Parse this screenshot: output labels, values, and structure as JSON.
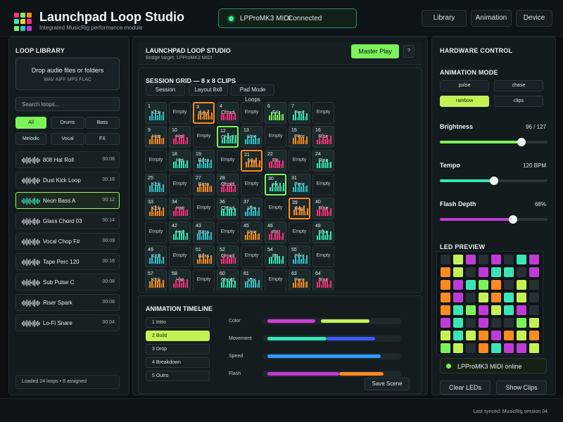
{
  "header": {
    "title": "Launchpad Loop Studio",
    "subtitle": "Integrated MusicRig performance module",
    "connection_device": "LPProMK3 MIDI",
    "connection_status": "Connected",
    "nav": [
      "Library",
      "Animation",
      "Device"
    ]
  },
  "library": {
    "title": "LOOP LIBRARY",
    "drop_title": "Drop audio files or folders",
    "drop_formats": "WAV  AIFF  MP3  FLAC",
    "search_placeholder": "Search loops...",
    "filters": [
      "All",
      "Drums",
      "Bass",
      "Melodic",
      "Vocal",
      "FX"
    ],
    "active_filter": "All",
    "loops": [
      {
        "name": "808 Hat Roll",
        "duration": "00:08"
      },
      {
        "name": "Dust Kick Loop",
        "duration": "00:16"
      },
      {
        "name": "Neon Bass A",
        "duration": "00:12"
      },
      {
        "name": "Glass Chord 03",
        "duration": "00:14"
      },
      {
        "name": "Vocal Chop F#",
        "duration": "00:09"
      },
      {
        "name": "Tape Perc 120",
        "duration": "00:16"
      },
      {
        "name": "Sub Pulse C",
        "duration": "00:08"
      },
      {
        "name": "Riser Spark",
        "duration": "00:06"
      },
      {
        "name": "Lo-Fi Snare",
        "duration": "00:04"
      }
    ],
    "active_loop": "Neon Bass A",
    "footer": "Loaded 24 loops  •  8 assigned"
  },
  "main": {
    "title": "LAUNCHPAD LOOP STUDIO",
    "bridge": "Bridge target: LPProMK3 MIDI",
    "master_play": "Master Play",
    "mini_btn": "?",
    "grid_title": "SESSION GRID — 8 x 8 CLIPS",
    "tabs": [
      "Session",
      "Layout 8x8",
      "Pad Mode Loops"
    ],
    "empty_label": "Empty",
    "pads": [
      [
        {
          "n": "1",
          "t": "Kick",
          "c": "#33c2c9"
        },
        {
          "e": 1
        },
        {
          "n": "3",
          "t": "Bass",
          "c": "#ff8a1f",
          "sel": 1
        },
        {
          "n": "4",
          "t": "Chord",
          "c": "#ff2e7e"
        },
        {
          "e": 1
        },
        {
          "n": "6",
          "t": "FX",
          "c": "#7cf25a"
        },
        {
          "n": "7",
          "t": "Perc",
          "c": "#39e6b5"
        },
        {
          "e": 1
        }
      ],
      [
        {
          "n": "9",
          "t": "Hat",
          "c": "#ff8a1f"
        },
        {
          "n": "10",
          "t": "Hat",
          "c": "#ff2e7e"
        },
        {
          "e": 1
        },
        {
          "n": "12",
          "t": "Chord",
          "c": "#39e6b5",
          "sel": 2
        },
        {
          "n": "13",
          "t": "Vox",
          "c": "#33c2c9"
        },
        {
          "e": 1
        },
        {
          "n": "15",
          "t": "Perc",
          "c": "#ff8a1f"
        },
        {
          "n": "16",
          "t": "Rise",
          "c": "#ff2e7e"
        }
      ],
      [
        {
          "e": 1
        },
        {
          "n": "18",
          "t": "Hat",
          "c": "#39e6b5"
        },
        {
          "n": "19",
          "t": "Bass",
          "c": "#33c2c9"
        },
        {
          "e": 1
        },
        {
          "n": "21",
          "t": "Vox",
          "c": "#ff8a1f",
          "sel": 1
        },
        {
          "n": "22",
          "t": "FX",
          "c": "#ff2e7e"
        },
        {
          "e": 1
        },
        {
          "n": "24",
          "t": "Rise",
          "c": "#39e6b5"
        }
      ],
      [
        {
          "n": "25",
          "t": "Kick",
          "c": "#33c2c9"
        },
        {
          "e": 1
        },
        {
          "n": "27",
          "t": "Bass",
          "c": "#ff8a1f"
        },
        {
          "n": "28",
          "t": "Chord",
          "c": "#ff2e7e"
        },
        {
          "e": 1
        },
        {
          "n": "30",
          "t": "FX",
          "c": "#39e6b5",
          "sel": 2
        },
        {
          "n": "31",
          "t": "Perc",
          "c": "#33c2c9"
        },
        {
          "e": 1
        }
      ],
      [
        {
          "n": "33",
          "t": "Kick",
          "c": "#ff8a1f"
        },
        {
          "n": "34",
          "t": "Hat",
          "c": "#ff2e7e"
        },
        {
          "e": 1
        },
        {
          "n": "36",
          "t": "Chord",
          "c": "#39e6b5"
        },
        {
          "n": "37",
          "t": "Vox",
          "c": "#33c2c9"
        },
        {
          "e": 1
        },
        {
          "n": "39",
          "t": "Perc",
          "c": "#ff8a1f",
          "sel": 1
        },
        {
          "n": "40",
          "t": "Rise",
          "c": "#ff2e7e"
        }
      ],
      [
        {
          "e": 1
        },
        {
          "n": "42",
          "t": "Hat",
          "c": "#39e6b5"
        },
        {
          "n": "43",
          "t": "Bass",
          "c": "#33c2c9"
        },
        {
          "e": 1
        },
        {
          "n": "45",
          "t": "Vox",
          "c": "#ff8a1f"
        },
        {
          "n": "46",
          "t": "FX",
          "c": "#ff2e7e"
        },
        {
          "e": 1
        },
        {
          "n": "48",
          "t": "Rise",
          "c": "#39e6b5"
        }
      ],
      [
        {
          "n": "49",
          "t": "Kick",
          "c": "#33c2c9"
        },
        {
          "e": 1
        },
        {
          "n": "51",
          "t": "Bass",
          "c": "#ff8a1f"
        },
        {
          "n": "52",
          "t": "Chord",
          "c": "#ff2e7e"
        },
        {
          "e": 1
        },
        {
          "n": "54",
          "t": "FX",
          "c": "#39e6b5"
        },
        {
          "n": "55",
          "t": "Perc",
          "c": "#33c2c9"
        },
        {
          "e": 1
        }
      ],
      [
        {
          "n": "57",
          "t": "Kick",
          "c": "#ff8a1f"
        },
        {
          "n": "58",
          "t": "Hat",
          "c": "#ff2e7e"
        },
        {
          "e": 1
        },
        {
          "n": "60",
          "t": "Chord",
          "c": "#39e6b5"
        },
        {
          "n": "61",
          "t": "Vox",
          "c": "#33c2c9"
        },
        {
          "e": 1
        },
        {
          "n": "63",
          "t": "Perc",
          "c": "#ff8a1f"
        },
        {
          "n": "64",
          "t": "Rise",
          "c": "#ff2e7e"
        }
      ]
    ]
  },
  "timeline": {
    "title": "ANIMATION TIMELINE",
    "scenes": [
      "1 Intro",
      "2 Build",
      "3 Drop",
      "4 Breakdown",
      "5 Outro"
    ],
    "active_scene": "2 Build",
    "tracks": [
      {
        "label": "Color",
        "segments": [
          {
            "from": 0.03,
            "to": 0.38,
            "color": "#d63bd6"
          },
          {
            "from": 0.42,
            "to": 0.77,
            "color": "#c4f255"
          }
        ]
      },
      {
        "label": "Movement",
        "segments": [
          {
            "from": 0.03,
            "to": 0.46,
            "color": "#39e6b5"
          },
          {
            "from": 0.46,
            "to": 0.81,
            "color": "#3b5bff"
          }
        ]
      },
      {
        "label": "Speed",
        "segments": [
          {
            "from": 0.03,
            "to": 0.85,
            "color": "#2f9dff"
          }
        ]
      },
      {
        "label": "Flash",
        "segments": [
          {
            "from": 0.03,
            "to": 0.55,
            "color": "#c03bd6"
          },
          {
            "from": 0.55,
            "to": 0.87,
            "color": "#ff8a1f"
          }
        ]
      }
    ],
    "save_label": "Save Scene"
  },
  "hardware": {
    "title": "HARDWARE CONTROL",
    "mode_title": "ANIMATION MODE",
    "modes": [
      "pulse",
      "chase",
      "rainbow",
      "clips"
    ],
    "active_mode": "rainbow",
    "sliders": [
      {
        "label": "Brightness",
        "value_text": "96 / 127",
        "fraction": 0.756,
        "color": "#7cf25a"
      },
      {
        "label": "Tempo",
        "value_text": "120 BPM",
        "fraction": 0.5,
        "color": "#39e6b5"
      },
      {
        "label": "Flash Depth",
        "value_text": "68%",
        "fraction": 0.68,
        "color": "#c03bd6"
      }
    ],
    "led_title": "LED PREVIEW",
    "led_colors": {
      "o": "#ff8a1f",
      "y": "#c4f255",
      "g": "#7cf25a",
      "t": "#39e6b5",
      "p": "#c03bd6",
      "k": "#252f34"
    },
    "led_rows": [
      "kypkpktp",
      "oykpttkp",
      "optgokyk",
      "opkyotyk",
      "otgpytpk",
      "ptkpkkgy",
      "ytyopoyo",
      "gykotppy"
    ],
    "online_text": "LPProMK3 MIDI online",
    "clear_label": "Clear LEDs",
    "show_label": "Show Clips"
  },
  "footer": {
    "text": "Last synced: MusicRig session 04"
  }
}
